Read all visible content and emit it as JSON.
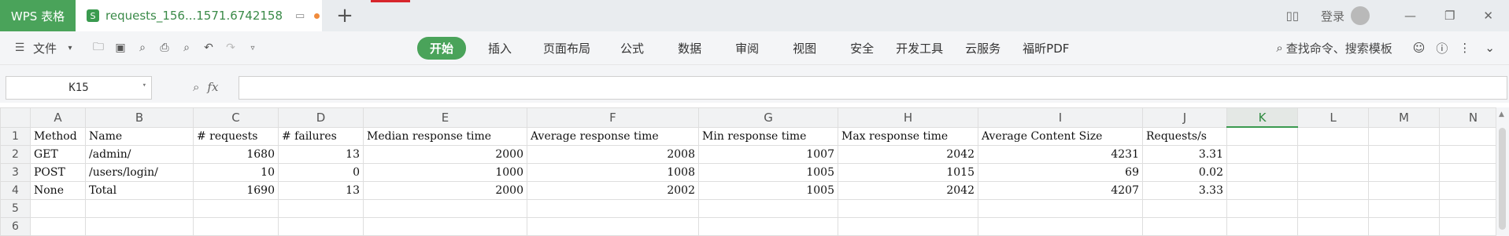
{
  "app": {
    "tab_label": "WPS 表格"
  },
  "document_tab": {
    "icon_letter": "S",
    "title": "requests_156...1571.6742158"
  },
  "window": {
    "login_label": "登录"
  },
  "toolbar": {
    "file_label": "文件",
    "menu": [
      "开始",
      "插入",
      "页面布局",
      "公式",
      "数据",
      "审阅",
      "视图",
      "安全",
      "开发工具",
      "云服务",
      "福昕PDF"
    ],
    "search_label": "查找命令、搜索模板"
  },
  "formula_bar": {
    "cell_ref": "K15",
    "fx": "fx",
    "value": ""
  },
  "sheet": {
    "columns": [
      "A",
      "B",
      "C",
      "D",
      "E",
      "F",
      "G",
      "H",
      "I",
      "J",
      "K",
      "L",
      "M",
      "N"
    ],
    "selected_column": "K",
    "rows": [
      {
        "n": "1",
        "cells": [
          "Method",
          "Name",
          "# requests",
          "# failures",
          "Median response time",
          "Average response time",
          "Min response time",
          "Max response time",
          "Average Content Size",
          "Requests/s",
          "",
          "",
          "",
          ""
        ]
      },
      {
        "n": "2",
        "cells": [
          "GET",
          "/admin/",
          "1680",
          "13",
          "2000",
          "2008",
          "1007",
          "2042",
          "4231",
          "3.31",
          "",
          "",
          "",
          ""
        ]
      },
      {
        "n": "3",
        "cells": [
          "POST",
          "/users/login/",
          "10",
          "0",
          "1000",
          "1008",
          "1005",
          "1015",
          "69",
          "0.02",
          "",
          "",
          "",
          ""
        ]
      },
      {
        "n": "4",
        "cells": [
          "None",
          "Total",
          "1690",
          "13",
          "2000",
          "2002",
          "1005",
          "2042",
          "4207",
          "3.33",
          "",
          "",
          "",
          ""
        ]
      },
      {
        "n": "5",
        "cells": [
          "",
          "",
          "",
          "",
          "",
          "",
          "",
          "",
          "",
          "",
          "",
          "",
          "",
          ""
        ]
      },
      {
        "n": "6",
        "cells": [
          "",
          "",
          "",
          "",
          "",
          "",
          "",
          "",
          "",
          "",
          "",
          "",
          "",
          ""
        ]
      }
    ]
  },
  "colors": {
    "accent": "#4aa35a",
    "tab_text": "#3a8a48",
    "modified_dot": "#f08b3c",
    "red_marker": "#d7262c"
  }
}
